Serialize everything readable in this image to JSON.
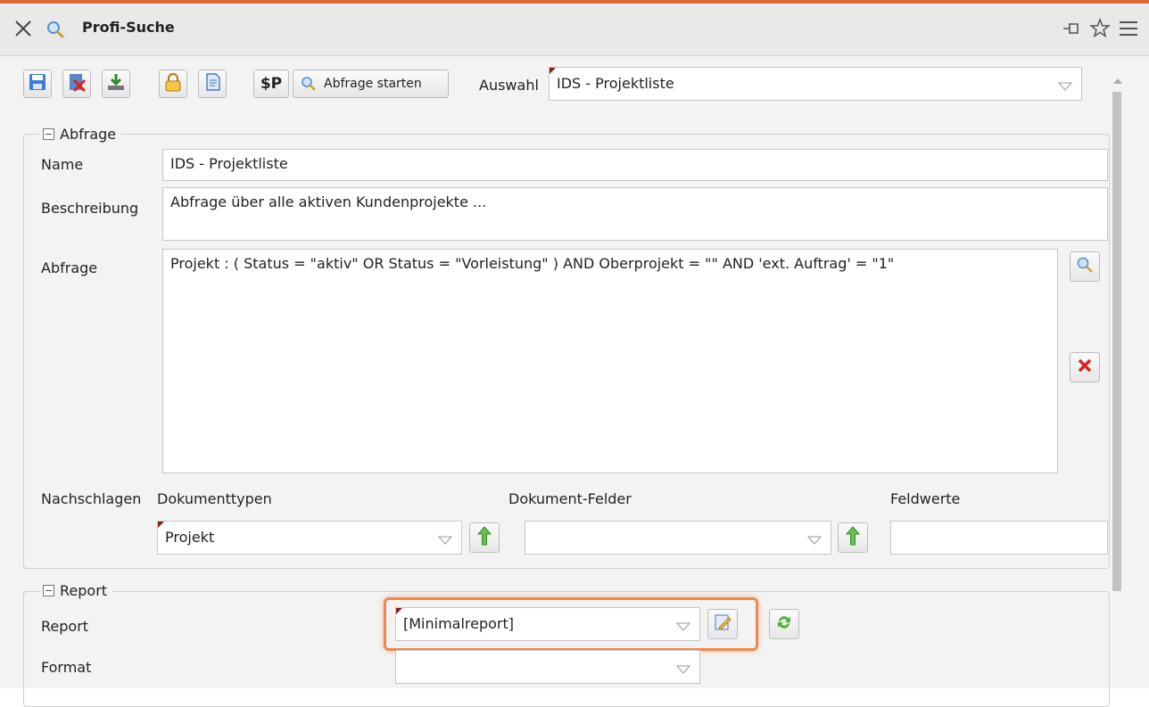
{
  "window": {
    "title": "Profi-Suche",
    "icons": [
      "close-icon",
      "search-icon",
      "pin-icon",
      "star-icon",
      "menu-icon"
    ]
  },
  "toolbar": {
    "dollar_label": "$P",
    "run_query_label": "Abfrage starten",
    "selection_label": "Auswahl",
    "selection_value": "IDS - Projektliste",
    "icons": [
      "save-icon",
      "delete-icon",
      "download-icon",
      "lock-icon",
      "document-icon"
    ]
  },
  "query_section": {
    "legend": "Abfrage",
    "name_label": "Name",
    "name_value": "IDS - Projektliste",
    "description_label": "Beschreibung",
    "description_value": "Abfrage über alle aktiven Kundenprojekte ...",
    "query_label": "Abfrage",
    "query_value": "Projekt : ( Status = \"aktiv\" OR Status = \"Vorleistung\" ) AND Oberprojekt = \"\" AND 'ext. Auftrag' = \"1\"",
    "lookup_label": "Nachschlagen",
    "doctypes_label": "Dokumenttypen",
    "doctypes_value": "Projekt",
    "docfields_label": "Dokument-Felder",
    "docfields_value": "",
    "fieldvalues_label": "Feldwerte",
    "fieldvalues_value": ""
  },
  "report_section": {
    "legend": "Report",
    "report_label": "Report",
    "report_value": "[Minimalreport]",
    "format_label": "Format",
    "format_value": ""
  },
  "colors": {
    "accent_line": "#e0673a",
    "highlight": "#f0874e",
    "required_flag": "#8b1d1d"
  }
}
